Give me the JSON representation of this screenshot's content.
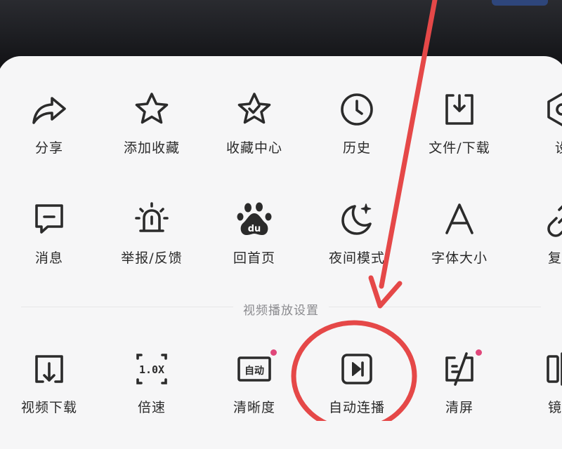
{
  "menu_rows": {
    "row1": [
      {
        "label": "分享",
        "icon": "share-icon"
      },
      {
        "label": "添加收藏",
        "icon": "star-icon"
      },
      {
        "label": "收藏中心",
        "icon": "star-check-icon"
      },
      {
        "label": "历史",
        "icon": "clock-icon"
      },
      {
        "label": "文件/下载",
        "icon": "download-box-icon"
      },
      {
        "label": "设",
        "icon": "settings-icon"
      }
    ],
    "row2": [
      {
        "label": "消息",
        "icon": "message-icon"
      },
      {
        "label": "举报/反馈",
        "icon": "alarm-light-icon"
      },
      {
        "label": "回首页",
        "icon": "baidu-paw-icon"
      },
      {
        "label": "夜间模式",
        "icon": "moon-icon"
      },
      {
        "label": "字体大小",
        "icon": "font-a-icon"
      },
      {
        "label": "复制",
        "icon": "link-icon"
      }
    ]
  },
  "video_section": {
    "title": "视频播放设置",
    "items": [
      {
        "label": "视频下载",
        "icon": "video-download-icon"
      },
      {
        "label": "倍速",
        "icon": "speed-icon",
        "icon_text": "1.0X"
      },
      {
        "label": "清晰度",
        "icon": "quality-icon",
        "icon_text": "自动",
        "badge": true
      },
      {
        "label": "自动连播",
        "icon": "autoplay-icon"
      },
      {
        "label": "清屏",
        "icon": "clear-screen-icon",
        "badge": true
      },
      {
        "label": "镜像",
        "icon": "mirror-icon"
      }
    ]
  },
  "colors": {
    "annotation": "#e54848",
    "badge": "#e0477a",
    "icon": "#2b2b2b",
    "sheet": "#f6f6f7"
  }
}
